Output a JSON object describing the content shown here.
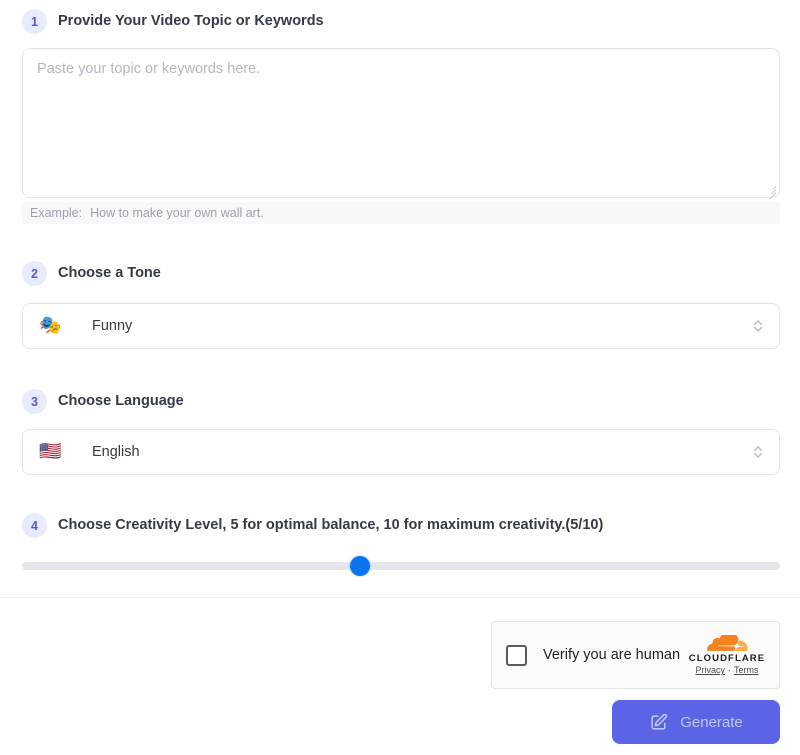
{
  "steps": [
    {
      "number": "1",
      "title": "Provide Your Video Topic or Keywords"
    },
    {
      "number": "2",
      "title": "Choose a Tone"
    },
    {
      "number": "3",
      "title": "Choose Language"
    },
    {
      "number": "4",
      "title": "Choose Creativity Level, 5 for optimal balance, 10 for maximum creativity.(5/10)"
    }
  ],
  "topic": {
    "value": "",
    "placeholder": "Paste your topic or keywords here.",
    "example_label": "Example:",
    "example_text": "How to make your own wall art."
  },
  "tone": {
    "emoji": "🎭",
    "icon_name": "performing-arts-emoji",
    "selected": "Funny",
    "chevron_icon": "chevron-up-down-icon"
  },
  "language": {
    "emoji": "🇺🇸",
    "icon_name": "us-flag-emoji",
    "selected": "English",
    "chevron_icon": "chevron-up-down-icon"
  },
  "creativity": {
    "value": 5,
    "min": 0,
    "max": 10,
    "display": "(5/10)",
    "thumb_percent": 44.6,
    "thumb_color": "#0a74f0",
    "track_color": "#e4e6eb"
  },
  "turnstile": {
    "label": "Verify you are human",
    "checked": false,
    "checkbox_icon": "checkbox-unchecked-icon",
    "brand": "CLOUDFLARE",
    "logo_icon": "cloudflare-cloud-icon",
    "privacy_link": "Privacy",
    "separator": "·",
    "terms_link": "Terms"
  },
  "generate": {
    "label": "Generate",
    "icon_name": "edit-square-icon",
    "color": "#5b63e6",
    "disabled": true
  },
  "theme": {
    "badge_bg": "#e8eafd",
    "badge_fg": "#4f5bd5",
    "border": "#e2e4ea",
    "text": "#343a48",
    "muted": "#9aa0ad"
  }
}
